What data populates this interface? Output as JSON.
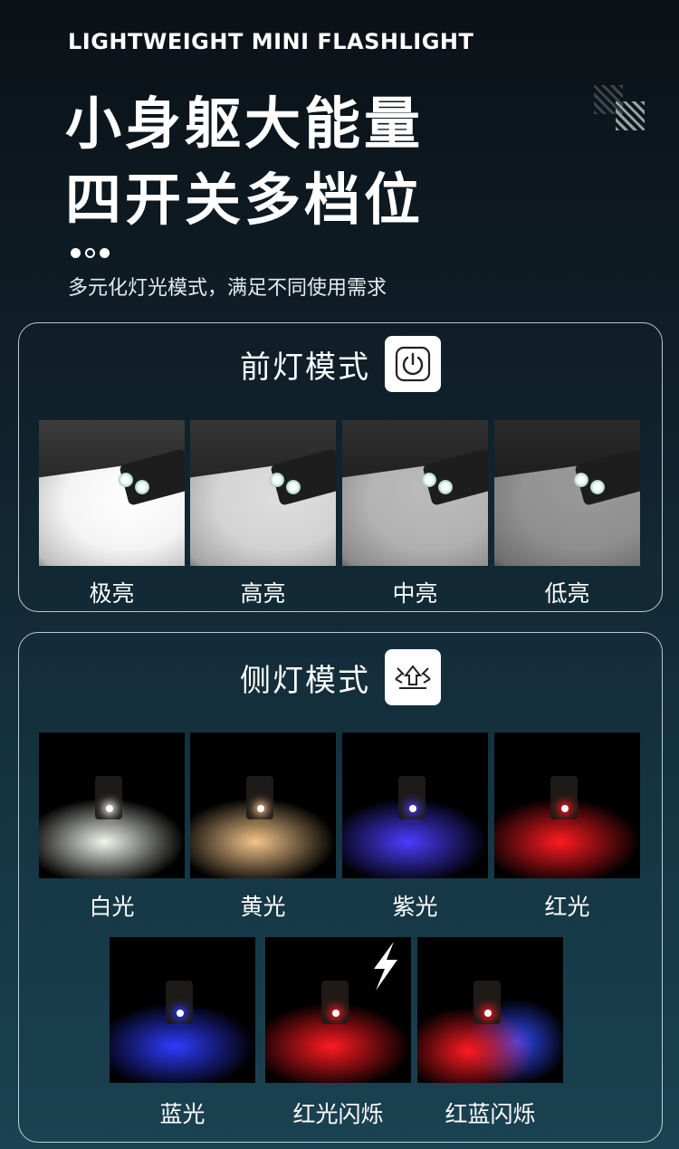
{
  "header": {
    "eyebrow": "LIGHTWEIGHT MINI FLASHLIGHT",
    "title_line1": "小身躯大能量",
    "title_line2": "四开关多档位",
    "subtitle": "多元化灯光模式，满足不同使用需求"
  },
  "front_mode": {
    "title": "前灯模式",
    "icon": "power-icon",
    "items": [
      {
        "label": "极亮",
        "brightness": 1.0
      },
      {
        "label": "高亮",
        "brightness": 0.85
      },
      {
        "label": "中亮",
        "brightness": 0.7
      },
      {
        "label": "低亮",
        "brightness": 0.55
      }
    ]
  },
  "side_mode": {
    "title": "侧灯模式",
    "icon": "side-light-icon",
    "items": [
      {
        "label": "白光",
        "color": "#f2f6ee"
      },
      {
        "label": "黄光",
        "color": "#f3c48a"
      },
      {
        "label": "紫光",
        "color": "#4b3cff"
      },
      {
        "label": "红光",
        "color": "#ff1a22"
      },
      {
        "label": "蓝光",
        "color": "#2f3bff"
      },
      {
        "label": "红光闪烁",
        "color": "#ff1a22",
        "flash": true
      },
      {
        "label": "红蓝闪烁",
        "color": "#ff1a22",
        "color2": "#2f4bff"
      }
    ],
    "flash_icon": "lightning-icon"
  }
}
